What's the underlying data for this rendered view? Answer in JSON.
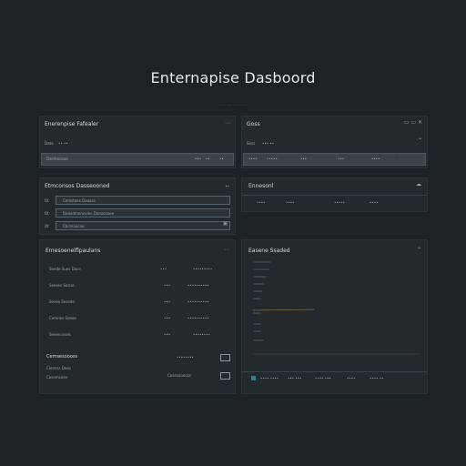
{
  "header": {
    "title": "Enternapise Dasboord",
    "subtitle": "........ ...... ....... ........."
  },
  "panel_tl": {
    "title": "Enerenpise Fafealer",
    "meta": [
      "Data",
      "•• ••"
    ],
    "bar_label": "Dasmecaae",
    "bar_items": [
      "•••",
      "••",
      "••"
    ]
  },
  "panel_tr": {
    "title": "Goss",
    "meta": [
      "Soss",
      "••• ••"
    ],
    "bar_items": [
      "••••",
      "•••••",
      "•••",
      "•••",
      "••••"
    ]
  },
  "panel_ml": {
    "title": "Etmconsos Dasseooned",
    "rows": [
      {
        "label": "Cemstaes Daooss",
        "tag": "Ot"
      },
      {
        "label": "Deaadmennvies Doeasoooe",
        "tag": "Ot"
      },
      {
        "label": "Cbcmaacee",
        "tag": "Ot"
      }
    ],
    "right_marker": "••"
  },
  "panel_mr": {
    "title": "Ennesonl",
    "cols": [
      "••••",
      "••••",
      "•••••",
      "••••"
    ]
  },
  "panel_bl": {
    "title": "Emesoenelflpaulans",
    "rows": [
      {
        "label": "Seede Sues Dace",
        "v1": "•••",
        "v2": "•••••••••"
      },
      {
        "label": "Seeses Sosne",
        "v1": "•••",
        "v2": "••••••••••"
      },
      {
        "label": "Seseo Sesede",
        "v1": "•••",
        "v2": "••••••••••"
      },
      {
        "label": "Cemnes Seeee",
        "v1": "•••",
        "v2": "••••••••••"
      },
      {
        "label": "Seeenceses",
        "v1": "•••",
        "v2": "••••••••"
      }
    ],
    "footer_label": "Cemsesoooss",
    "footer_sub": "Cleenss Dase",
    "footer_value": "Cosesooecos"
  },
  "panel_br": {
    "title": "Easene Ssaded",
    "legend": [
      "•••• ••••",
      "••• •••",
      "•••• •••",
      "••••",
      "•••• ••"
    ]
  },
  "icons": {
    "menu": "more-icon",
    "cloud": "cloud-icon",
    "window": "window-controls-icon",
    "chart_line_color": "#8a6a3a"
  }
}
